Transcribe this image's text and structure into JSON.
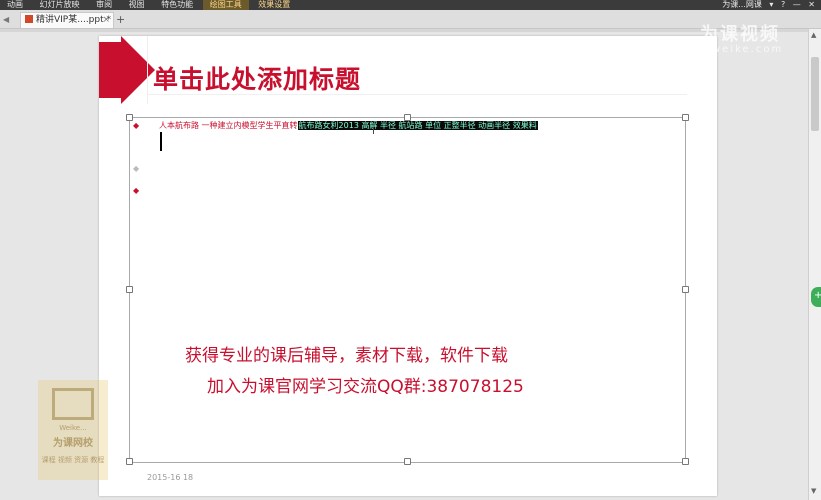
{
  "menubar": {
    "items": [
      "动画",
      "幻灯片放映",
      "审阅",
      "视图",
      "特色功能",
      "绘图工具",
      "效果设置"
    ],
    "right": [
      "为课...网课",
      "▾",
      "?",
      "—",
      "✕"
    ]
  },
  "tabbar": {
    "doc_tab": "精讲VIP某....ppt *",
    "new_tab": "+"
  },
  "slide": {
    "title": "单击此处添加标题",
    "line1_plain": "人本航布路  一种建立内模型学生平直转",
    "line1_selected": "航布路女利2013  高解  半径  航站路  单位  正整半径  动画半径  效果料",
    "promo_line1": "获得专业的课后辅导，素材下载，软件下载",
    "promo_line2": "加入为课官网学习交流QQ群:387078125",
    "date": "2015-16 18"
  },
  "watermark": {
    "logo_line1": "Weike...",
    "logo_line2": "为课网校",
    "logo_line3": "课程  视频  资源  教程",
    "top_text": "为课视频",
    "top_sub": "weike.com"
  },
  "colors": {
    "accent": "#c8102e",
    "menubar_bg": "#3b3b3b",
    "selection_bg": "#0a0a0a"
  }
}
